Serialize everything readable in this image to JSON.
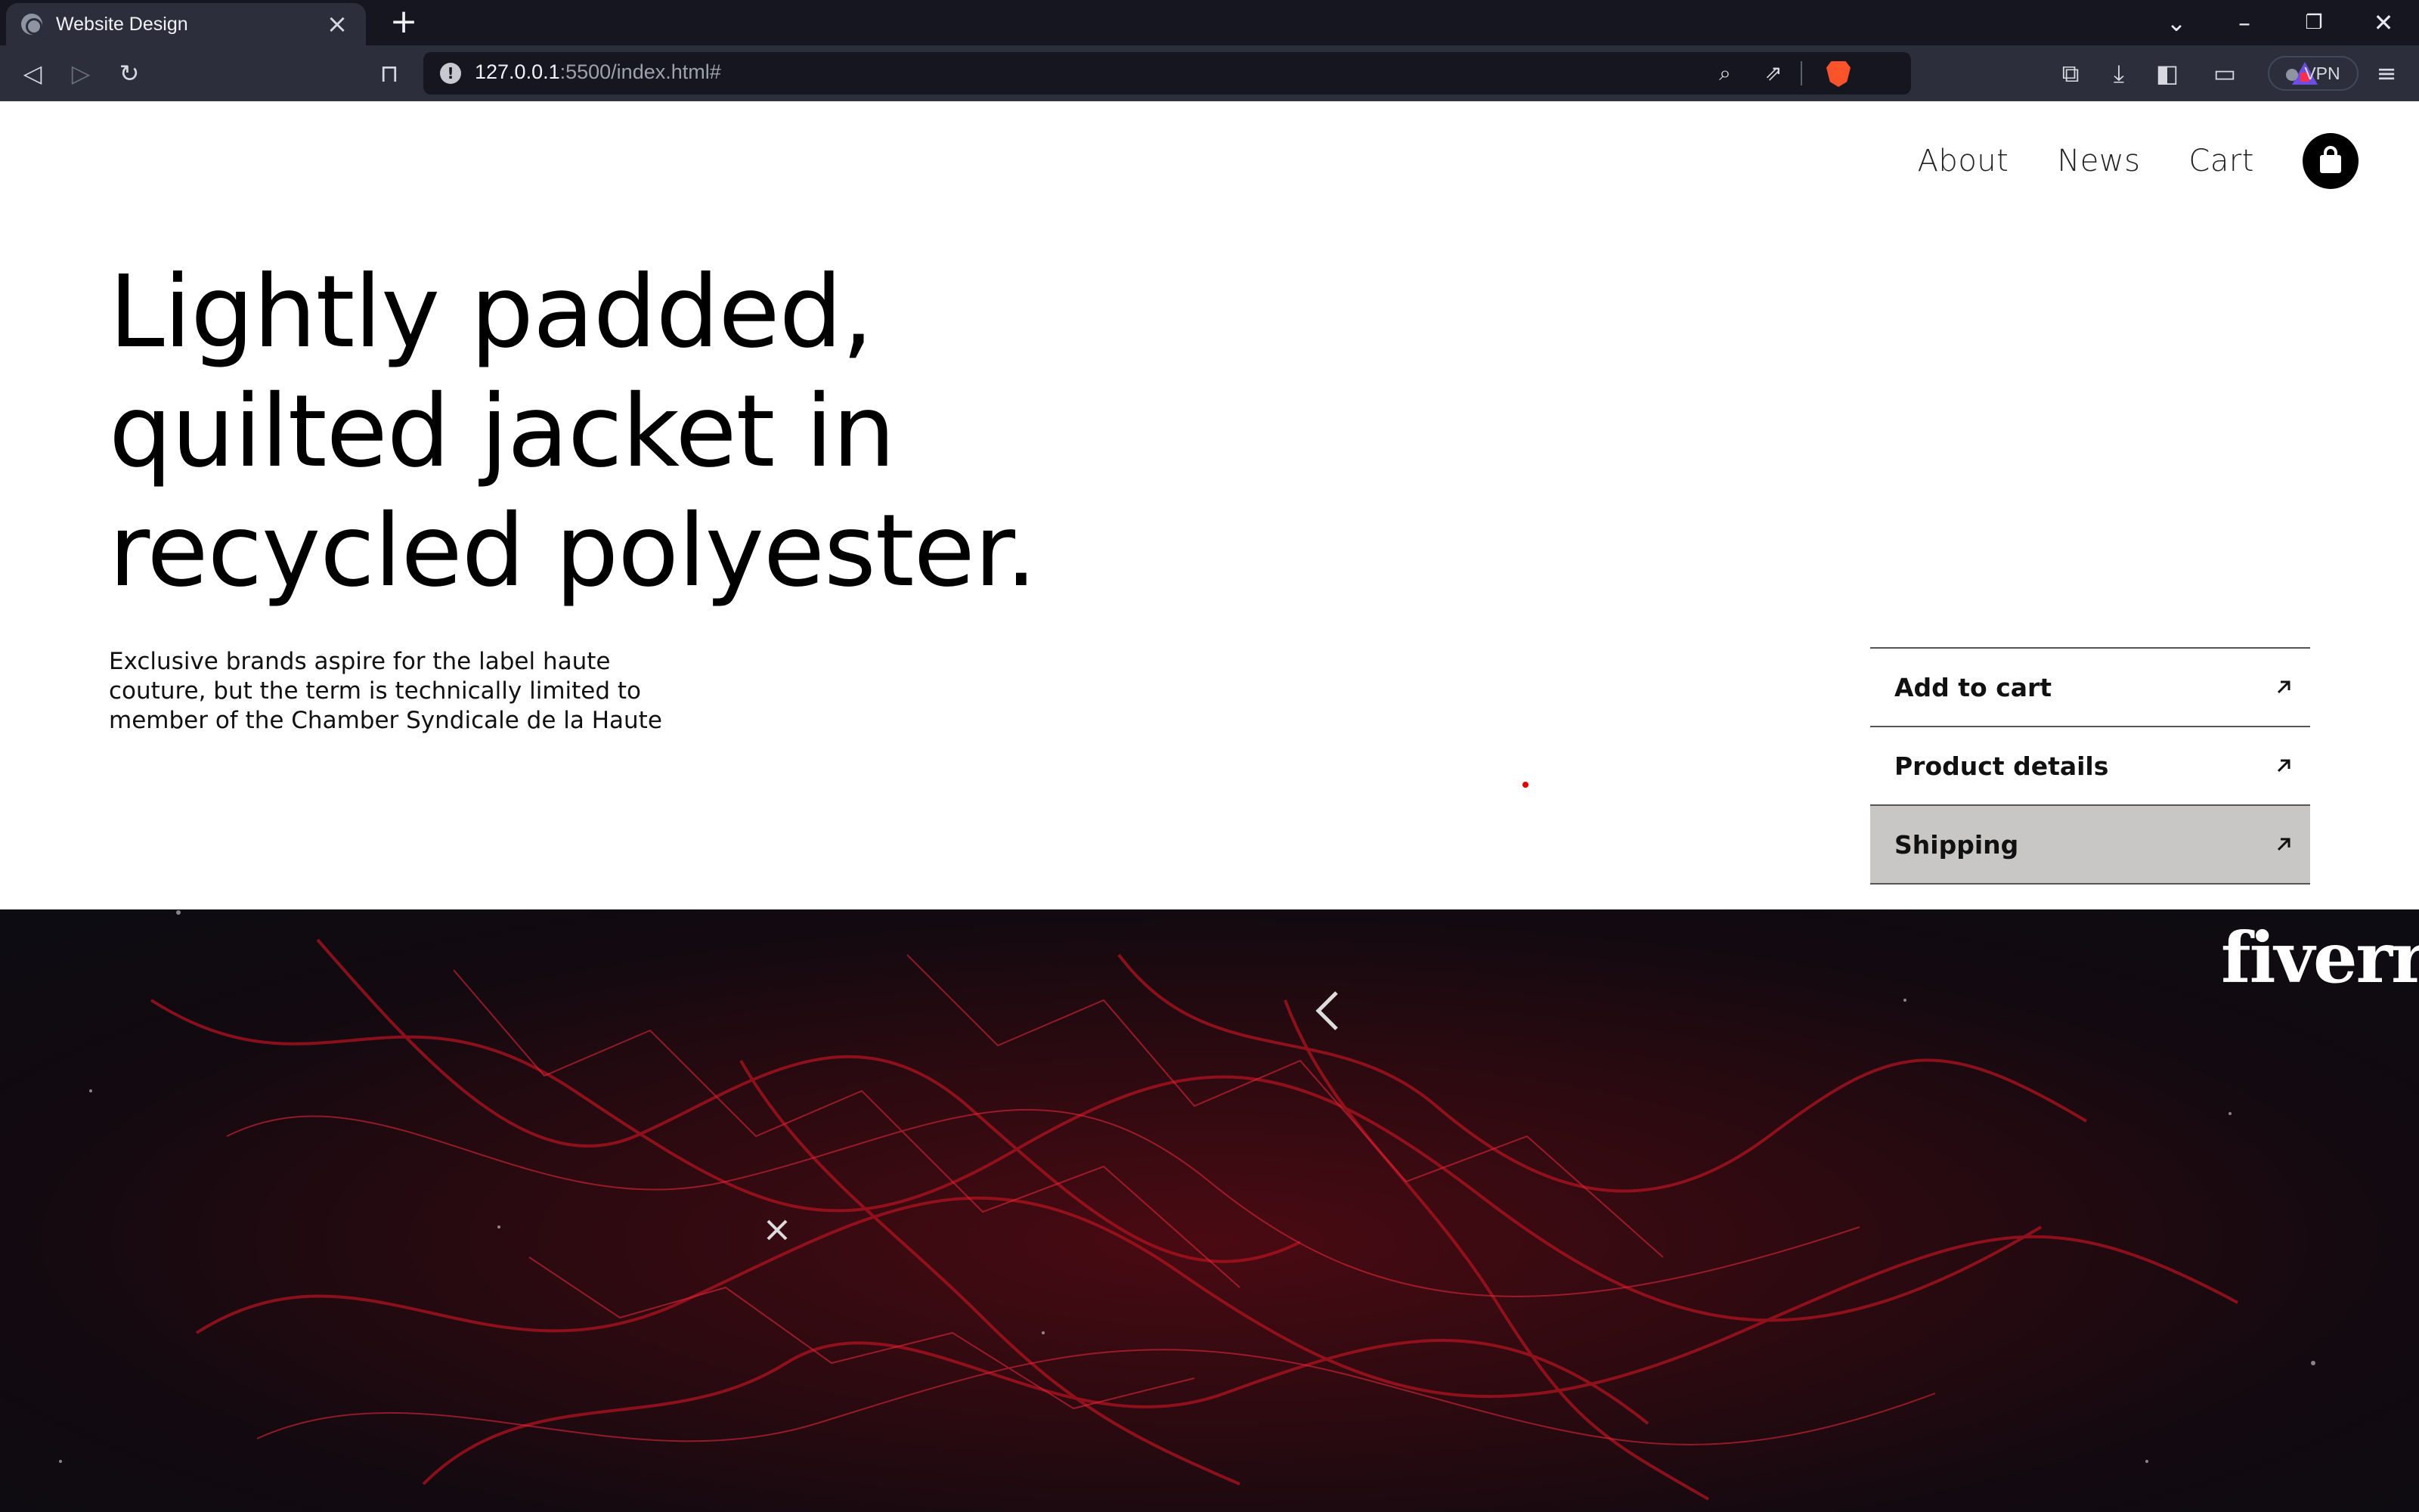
{
  "browser": {
    "tab_title": "Website Design",
    "url_host": "127.0.0.1",
    "url_rest": ":5500/index.html#",
    "vpn_label": "VPN"
  },
  "nav": {
    "items": [
      {
        "label": "About"
      },
      {
        "label": "News"
      },
      {
        "label": "Cart"
      }
    ]
  },
  "hero_text": {
    "headline_lines": [
      "Lightly padded,",
      "quilted jacket in",
      "recycled polyester."
    ],
    "blurb_lines": [
      "Exclusive brands aspire for the label haute",
      "couture, but the term is technically limited to",
      "member of the Chamber Syndicale de la Haute"
    ]
  },
  "actions": [
    {
      "label": "Add to cart",
      "active": false
    },
    {
      "label": "Product details",
      "active": false
    },
    {
      "label": "Shipping",
      "active": true
    }
  ],
  "video": {
    "watermark": "fiverr"
  },
  "colors": {
    "accent": "#000000",
    "active_row": "#c9c6c6",
    "hero_red": "#c0142a"
  }
}
